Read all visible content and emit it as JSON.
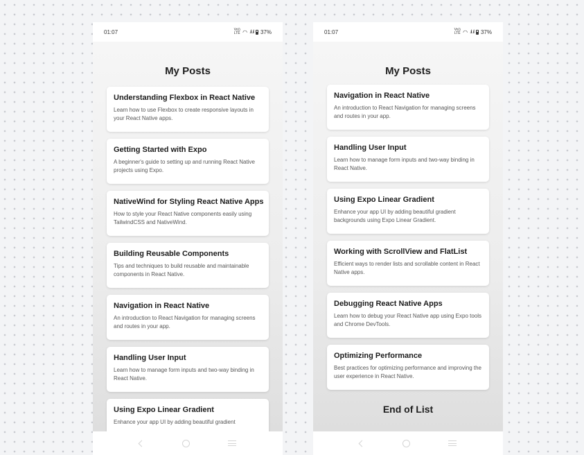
{
  "status_bar": {
    "time": "01:07",
    "volte": "Vo)) LTE",
    "wifi_icon": "wifi-icon",
    "signal_glyph": ".ıl .ıl",
    "battery": "37%"
  },
  "left_screen": {
    "title": "My Posts",
    "posts": [
      {
        "title": "Understanding Flexbox in React Native",
        "description": "Learn how to use Flexbox to create responsive layouts in your React Native apps."
      },
      {
        "title": "Getting Started with Expo",
        "description": "A beginner's guide to setting up and running React Native projects using Expo."
      },
      {
        "title": "NativeWind for Styling React Native Apps",
        "description": "How to style your React Native components easily using TailwindCSS and NativeWind."
      },
      {
        "title": "Building Reusable Components",
        "description": "Tips and techniques to build reusable and maintainable components in React Native."
      },
      {
        "title": "Navigation in React Native",
        "description": "An introduction to React Navigation for managing screens and routes in your app."
      },
      {
        "title": "Handling User Input",
        "description": "Learn how to manage form inputs and two-way binding in React Native."
      },
      {
        "title": "Using Expo Linear Gradient",
        "description": "Enhance your app UI by adding beautiful gradient"
      }
    ]
  },
  "right_screen": {
    "title": "My Posts",
    "posts": [
      {
        "title": "Navigation in React Native",
        "description": "An introduction to React Navigation for managing screens and routes in your app."
      },
      {
        "title": "Handling User Input",
        "description": "Learn how to manage form inputs and two-way binding in React Native."
      },
      {
        "title": "Using Expo Linear Gradient",
        "description": "Enhance your app UI by adding beautiful gradient backgrounds using Expo Linear Gradient."
      },
      {
        "title": "Working with ScrollView and FlatList",
        "description": "Efficient ways to render lists and scrollable content in React Native apps."
      },
      {
        "title": "Debugging React Native Apps",
        "description": "Learn how to debug your React Native app using Expo tools and Chrome DevTools."
      },
      {
        "title": "Optimizing Performance",
        "description": "Best practices for optimizing performance and improving the user experience in React Native."
      }
    ],
    "end_text": "End of List"
  },
  "nav_bar": {
    "icons": [
      "back-icon",
      "home-icon",
      "menu-icon"
    ]
  }
}
